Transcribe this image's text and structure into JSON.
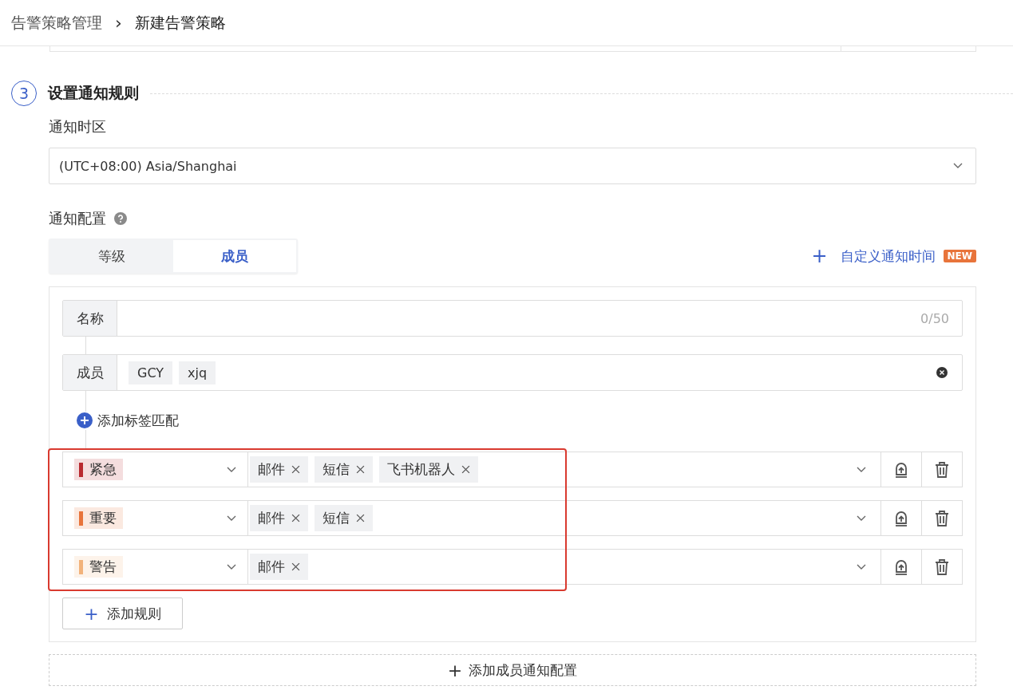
{
  "breadcrumb": {
    "parent": "告警策略管理",
    "separator": "›",
    "current": "新建告警策略"
  },
  "step": {
    "number": "3",
    "title": "设置通知规则"
  },
  "timezone": {
    "label": "通知时区",
    "value": "(UTC+08:00) Asia/Shanghai"
  },
  "notify_config": {
    "label": "通知配置",
    "tabs": [
      {
        "label": "等级",
        "selected": false
      },
      {
        "label": "成员",
        "selected": true
      }
    ],
    "custom_time_link": {
      "icon": "+",
      "label": "自定义通知时间",
      "badge": "NEW"
    }
  },
  "member_config": {
    "name_field": {
      "label": "名称",
      "counter": "0/50"
    },
    "members_field": {
      "label": "成员",
      "tags": [
        "GCY",
        "xjq"
      ]
    },
    "add_tag_match": "添加标签匹配",
    "rules": [
      {
        "level": "紧急",
        "color": "#b8292f",
        "channels": [
          "邮件",
          "短信",
          "飞书机器人"
        ]
      },
      {
        "level": "重要",
        "color": "#e8743b",
        "channels": [
          "邮件",
          "短信"
        ]
      },
      {
        "level": "警告",
        "color": "#f2b27a",
        "channels": [
          "邮件"
        ]
      }
    ],
    "add_rule": {
      "icon": "+",
      "label": "添加规则"
    }
  },
  "add_member_config": {
    "icon": "+",
    "label": "添加成员通知配置"
  }
}
